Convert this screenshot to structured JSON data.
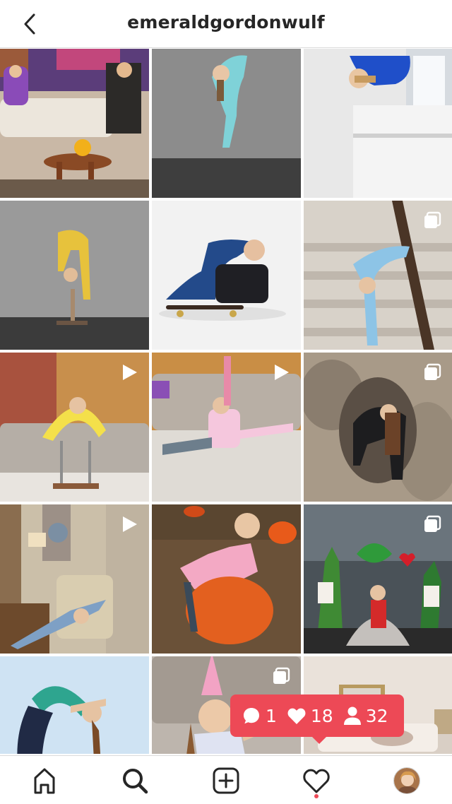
{
  "header": {
    "title": "emeraldgordonwulf",
    "back_icon": "chevron-left-icon"
  },
  "grid": {
    "posts": [
      {
        "type": "photo",
        "scene": "tv studio couch"
      },
      {
        "type": "photo",
        "scene": "grey wall backbend"
      },
      {
        "type": "photo",
        "scene": "white window ledge"
      },
      {
        "type": "photo",
        "scene": "handstand canes"
      },
      {
        "type": "photo",
        "scene": "skateboard pose"
      },
      {
        "type": "carousel",
        "scene": "stairs backbend"
      },
      {
        "type": "video",
        "scene": "living room canes"
      },
      {
        "type": "video",
        "scene": "living room floor"
      },
      {
        "type": "carousel",
        "scene": "rock cave"
      },
      {
        "type": "video",
        "scene": "attic room"
      },
      {
        "type": "photo",
        "scene": "pumpkin field"
      },
      {
        "type": "carousel",
        "scene": "wonderland set"
      },
      {
        "type": "photo",
        "scene": "sky backbend"
      },
      {
        "type": "carousel",
        "scene": "party hat"
      },
      {
        "type": "photo",
        "scene": "bedroom"
      }
    ]
  },
  "activity_popup": {
    "comments": "1",
    "likes": "18",
    "followers": "32",
    "color": "#ed4956"
  },
  "bottom_nav": {
    "items": [
      "home-icon",
      "search-icon",
      "add-post-icon",
      "activity-heart-icon",
      "profile-avatar"
    ],
    "notification_dot_color": "#ed4956"
  }
}
